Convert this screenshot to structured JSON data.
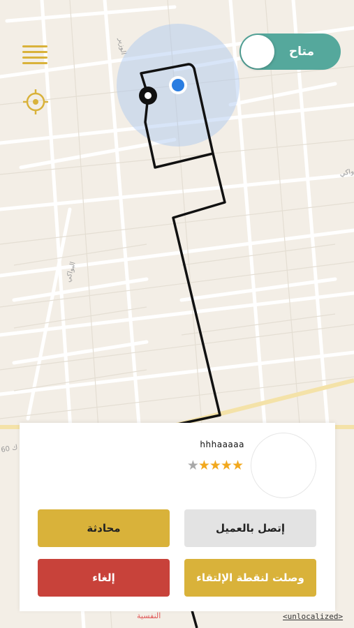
{
  "status_toggle": {
    "label": "متاح",
    "on": true,
    "accent": "#55a89c"
  },
  "map": {
    "street_labels": [
      "الوزير",
      "واكي",
      "البواكي",
      "ك 60",
      "النفسية"
    ],
    "route_color": "#111111",
    "accuracy_circle_color": "#a9c6ef",
    "location_dot_color": "#2a7de1"
  },
  "customer": {
    "name": "hhhaaaaa",
    "rating": 4,
    "rating_max": 5
  },
  "buttons": {
    "call": "إتصل بالعميل",
    "chat": "محادثة",
    "arrived": "وصلت لنقطة الإلتقاء",
    "cancel": "إلغاء"
  },
  "footer_link": "<unlocalized>",
  "colors": {
    "gold": "#d9b23a",
    "red": "#c8423a",
    "grey": "#e3e3e3"
  }
}
